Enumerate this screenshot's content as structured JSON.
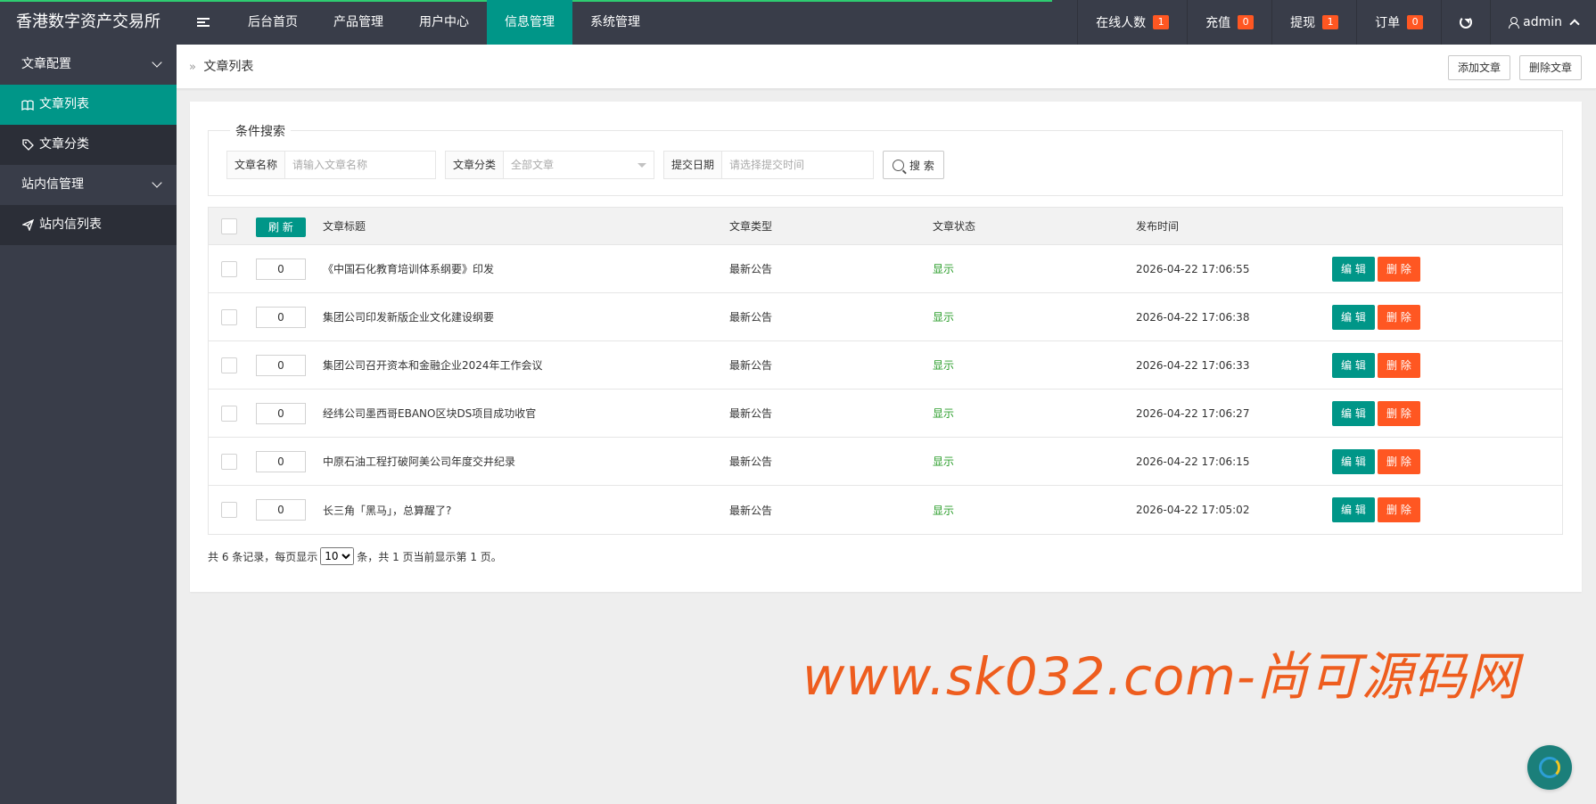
{
  "brand": "香港数字资产交易所",
  "nav": {
    "items": [
      "后台首页",
      "产品管理",
      "用户中心",
      "信息管理",
      "系统管理"
    ],
    "active_index": 3
  },
  "right_nav": {
    "online_label": "在线人数",
    "online_count": "1",
    "recharge_label": "充值",
    "recharge_count": "0",
    "withdraw_label": "提现",
    "withdraw_count": "1",
    "order_label": "订单",
    "order_count": "0",
    "user": "admin"
  },
  "sidebar": {
    "group1": "文章配置",
    "item_article_list": "文章列表",
    "item_article_category": "文章分类",
    "group2": "站内信管理",
    "item_message_list": "站内信列表"
  },
  "breadcrumb": "文章列表",
  "toolbar": {
    "add_label": "添加文章",
    "delete_label": "删除文章"
  },
  "search": {
    "legend": "条件搜索",
    "name_label": "文章名称",
    "name_placeholder": "请输入文章名称",
    "category_label": "文章分类",
    "category_value": "全部文章",
    "date_label": "提交日期",
    "date_placeholder": "请选择提交时间",
    "button": "搜 索"
  },
  "table": {
    "refresh_label": "刷 新",
    "headers": {
      "title": "文章标题",
      "type": "文章类型",
      "status": "文章状态",
      "time": "发布时间"
    },
    "edit_label": "编 辑",
    "delete_label": "删 除",
    "rows": [
      {
        "sort": "0",
        "title": "《中国石化教育培训体系纲要》印发",
        "type": "最新公告",
        "status": "显示",
        "time": "2026-04-22 17:06:55"
      },
      {
        "sort": "0",
        "title": "集团公司印发新版企业文化建设纲要",
        "type": "最新公告",
        "status": "显示",
        "time": "2026-04-22 17:06:38"
      },
      {
        "sort": "0",
        "title": "集团公司召开资本和金融企业2024年工作会议",
        "type": "最新公告",
        "status": "显示",
        "time": "2026-04-22 17:06:33"
      },
      {
        "sort": "0",
        "title": "经纬公司墨西哥EBANO区块DS项目成功收官",
        "type": "最新公告",
        "status": "显示",
        "time": "2026-04-22 17:06:27"
      },
      {
        "sort": "0",
        "title": "中原石油工程打破阿美公司年度交井纪录",
        "type": "最新公告",
        "status": "显示",
        "time": "2026-04-22 17:06:15"
      },
      {
        "sort": "0",
        "title": "长三角「黑马」，总算醒了?",
        "type": "最新公告",
        "status": "显示",
        "time": "2026-04-22 17:05:02"
      }
    ]
  },
  "pager": {
    "prefix": "共 6 条记录，每页显示",
    "page_size": "10",
    "suffix": "条，共 1 页当前显示第 1 页。"
  },
  "watermark": "www.sk032.com-尚可源码网",
  "colors": {
    "header": "#393d49",
    "accent": "#009688",
    "danger": "#ff5722",
    "status_ok": "#2a9d2a"
  }
}
